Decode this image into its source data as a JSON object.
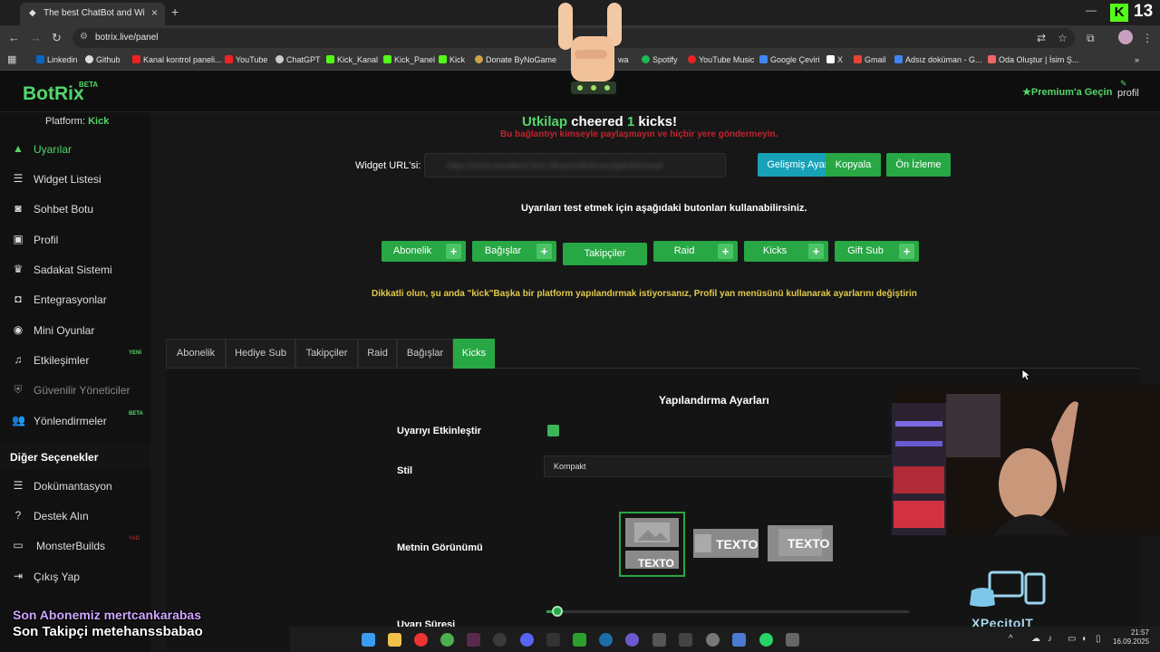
{
  "browser": {
    "tab_title": "The best ChatBot and Widgets",
    "url": "botrix.live/panel",
    "kick_count": "13",
    "bookmarks": [
      "Linkedin",
      "Github",
      "Kanal kontrol paneli...",
      "YouTube",
      "ChatGPT",
      "Kick_Kanal",
      "Kick_Panel",
      "Kick",
      "Donate ByNoGame",
      "wa",
      "Spotify",
      "YouTube Music",
      "Google Çeviri",
      "X",
      "Gmail",
      "Adsız doküman - G...",
      "Oda Oluştur | İsim Ş..."
    ]
  },
  "header": {
    "logo": "BotRix",
    "logo_badge": "BETA",
    "premium": "Premium'a Geçin",
    "profile": "profil"
  },
  "sidebar": {
    "platform_label": "Platform:",
    "platform_value": "Kick",
    "items": [
      {
        "label": "Uyarılar",
        "badge": ""
      },
      {
        "label": "Widget Listesi",
        "badge": ""
      },
      {
        "label": "Sohbet Botu",
        "badge": ""
      },
      {
        "label": "Profil",
        "badge": ""
      },
      {
        "label": "Sadakat Sistemi",
        "badge": ""
      },
      {
        "label": "Entegrasyonlar",
        "badge": ""
      },
      {
        "label": "Mini Oyunlar",
        "badge": ""
      },
      {
        "label": "Etkileşimler",
        "badge": "YENİ"
      },
      {
        "label": "Güvenilir Yöneticiler",
        "badge": ""
      },
      {
        "label": "Yönlendirmeler",
        "badge": "BETA"
      }
    ],
    "other_heading": "Diğer Seçenekler",
    "other_items": [
      {
        "label": "Dokümantasyon",
        "badge": ""
      },
      {
        "label": "Destek Alın",
        "badge": ""
      },
      {
        "label": "MonsterBuilds",
        "badge": "YAD"
      },
      {
        "label": "Çıkış Yap",
        "badge": ""
      }
    ]
  },
  "main": {
    "alert_user": "Utkilap",
    "alert_mid": "cheered",
    "alert_amount": "1",
    "alert_end": "kicks!",
    "warning": "Bu bağlantıyı kimseyle paylaşmayın ve hiçbir yere göndermeyin.",
    "widget_url_label": "Widget URL'si:",
    "widget_url_value": "https://botrix.live/alerts?bid=2fbac0e5fb2f1ea1fg8cf0bd1ea4",
    "btn_advanced": "Gelişmiş Ayarlar",
    "btn_copy": "Kopyala",
    "btn_preview": "Ön İzleme",
    "test_info": "Uyarıları test etmek için aşağıdaki butonları kullanabilirsiniz.",
    "test_buttons": [
      "Abonelik",
      "Bağışlar",
      "Takipçiler",
      "Raid",
      "Kicks",
      "Gift Sub"
    ],
    "note": "Dikkatli olun, şu anda \"kick\"Başka bir platform yapılandırmak istiyorsanız, Profil yan menüsünü kullanarak ayarlarını değiştirin",
    "tabs": [
      "Abonelik",
      "Hediye Sub",
      "Takipçiler",
      "Raid",
      "Bağışlar",
      "Kicks"
    ],
    "active_tab": "Kicks",
    "config_title": "Yapılandırma Ayarları",
    "enable_label": "Uyarıyı Etkinleştir",
    "enable_checked": true,
    "style_label": "Stil",
    "style_value": "Kompakt",
    "text_view_label": "Metnin Görünümü",
    "thumb_text": "TEXTO",
    "duration_label": "Uyarı Süresi",
    "duration_fraction": 0.03
  },
  "overlay": {
    "last_sub": "Son Abonemiz mertcankarabas",
    "last_follower": "Son Takipçi metehanssbabao",
    "brand": "XPecitoIT"
  },
  "taskbar": {
    "time": "21:57",
    "date": "16.09.2025"
  },
  "colors": {
    "accent": "#28a745",
    "brand_green": "#53d769",
    "info": "#17a2b8",
    "warning_red": "#c0242f",
    "note_yellow": "#e2c94b"
  }
}
